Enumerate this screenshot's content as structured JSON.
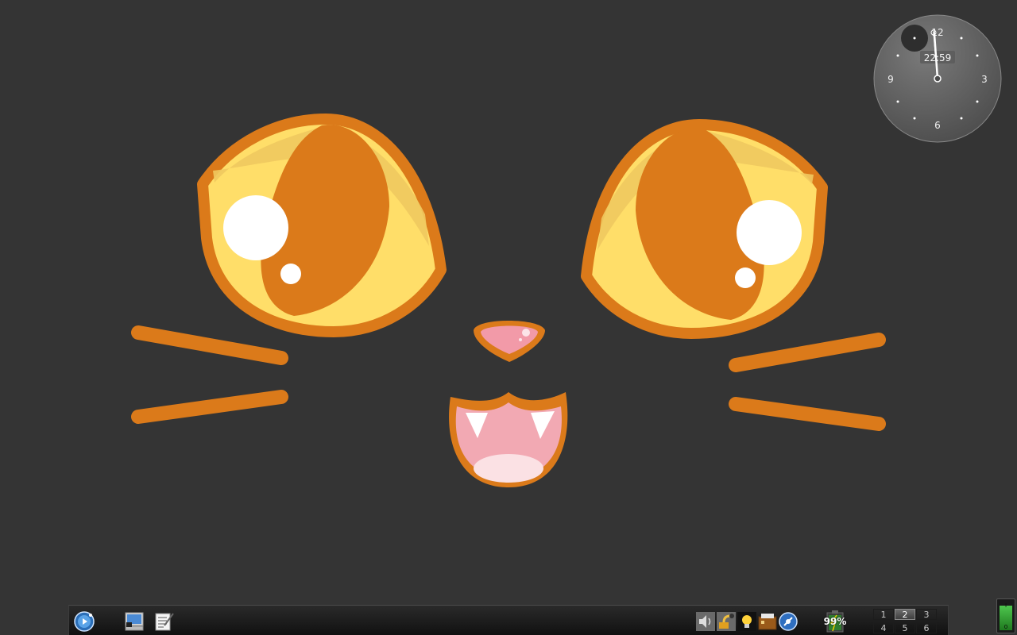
{
  "wallpaper": {
    "description_icon": "cat-face-icon",
    "colors": {
      "background": "#343434",
      "orange": "#db7a1a",
      "yellow": "#ffde69",
      "pink": "#f29aa8"
    }
  },
  "clock": {
    "numerals": {
      "twelve": "12",
      "three": "3",
      "six": "6",
      "nine": "9"
    },
    "digital_time": "22:59"
  },
  "taskbar": {
    "launchers": [
      {
        "icon": "start-menu-icon"
      },
      {
        "icon": "computer-icon"
      },
      {
        "icon": "text-editor-icon"
      }
    ],
    "tray": [
      {
        "icon": "volume-icon"
      },
      {
        "icon": "network-icon"
      },
      {
        "icon": "lightbulb-icon"
      },
      {
        "icon": "archive-icon"
      },
      {
        "icon": "browser-icon"
      }
    ],
    "battery": {
      "icon": "battery-icon",
      "percent_label": "99%"
    },
    "pager": {
      "desktops": [
        "1",
        "2",
        "3",
        "4",
        "5",
        "6"
      ],
      "active_index": 1
    }
  },
  "volume_widget": {
    "top_label": "I",
    "bottom_label": "0",
    "level_percent": 85
  }
}
